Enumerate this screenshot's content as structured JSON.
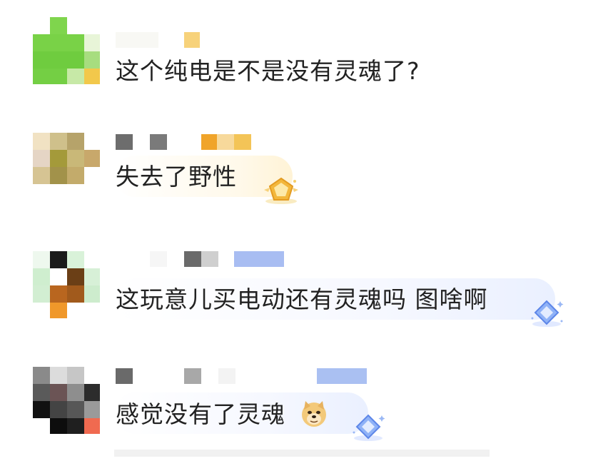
{
  "comments": [
    {
      "text": "这个纯电是不是没有灵魂了?",
      "badge_icon": "none"
    },
    {
      "text": "失去了野性",
      "badge_icon": "gold-pentagon-badge-icon"
    },
    {
      "text": "这玩意儿买电动还有灵魂吗 图啥啊",
      "badge_icon": "blue-diamond-badge-icon"
    },
    {
      "text": "感觉没有了灵魂",
      "emoji": "doge-emoji-icon",
      "badge_icon": "blue-diamond-badge-icon"
    }
  ]
}
